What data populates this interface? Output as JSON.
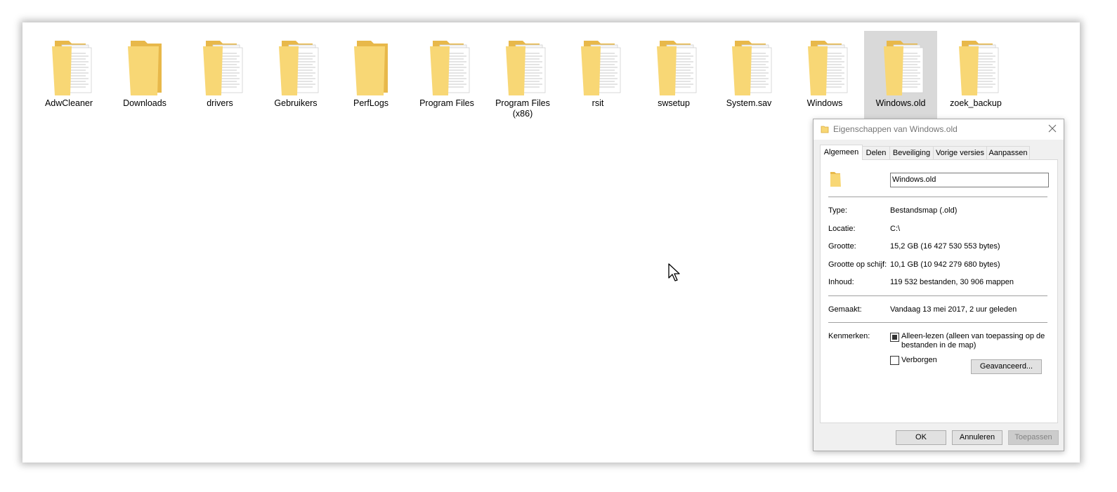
{
  "folders": [
    {
      "label": "AdwCleaner",
      "icon": "folder-with-documents-icon"
    },
    {
      "label": "Downloads",
      "icon": "folder-icon"
    },
    {
      "label": "drivers",
      "icon": "folder-with-documents-icon"
    },
    {
      "label": "Gebruikers",
      "icon": "folder-with-documents-icon"
    },
    {
      "label": "PerfLogs",
      "icon": "folder-icon"
    },
    {
      "label": "Program Files",
      "icon": "folder-with-documents-icon"
    },
    {
      "label": "Program Files\n(x86)",
      "icon": "folder-with-documents-icon"
    },
    {
      "label": "rsit",
      "icon": "folder-with-documents-icon"
    },
    {
      "label": "swsetup",
      "icon": "folder-with-documents-icon"
    },
    {
      "label": "System.sav",
      "icon": "folder-with-documents-icon"
    },
    {
      "label": "Windows",
      "icon": "folder-with-documents-icon"
    },
    {
      "label": "Windows.old",
      "icon": "folder-with-documents-icon",
      "selected": true
    },
    {
      "label": "zoek_backup",
      "icon": "folder-with-documents-icon"
    }
  ],
  "dialog": {
    "title": "Eigenschappen van Windows.old",
    "tabs": [
      "Algemeen",
      "Delen",
      "Beveiliging",
      "Vorige versies",
      "Aanpassen"
    ],
    "active_tab": "Algemeen",
    "name_value": "Windows.old",
    "properties": {
      "type_label": "Type:",
      "type_value": "Bestandsmap (.old)",
      "location_label": "Locatie:",
      "location_value": "C:\\",
      "size_label": "Grootte:",
      "size_value": "15,2 GB (16 427 530 553 bytes)",
      "disk_size_label": "Grootte op schijf:",
      "disk_size_value": "10,1 GB (10 942 279 680 bytes)",
      "contents_label": "Inhoud:",
      "contents_value": "119 532 bestanden, 30 906 mappen",
      "created_label": "Gemaakt:",
      "created_value": "Vandaag 13 mei 2017, 2 uur geleden"
    },
    "attributes": {
      "label": "Kenmerken:",
      "readonly_label": "Alleen-lezen (alleen van toepassing op de bestanden in de map)",
      "readonly_state": "indeterminate",
      "hidden_label": "Verborgen",
      "hidden_checked": false,
      "advanced_button": "Geavanceerd..."
    },
    "buttons": {
      "ok": "OK",
      "cancel": "Annuleren",
      "apply": "Toepassen"
    }
  },
  "colors": {
    "folder_body": "#f8d775",
    "folder_back": "#e8b84a",
    "selection": "#d9d9d9",
    "dialog_bg": "#f0f0f0"
  }
}
